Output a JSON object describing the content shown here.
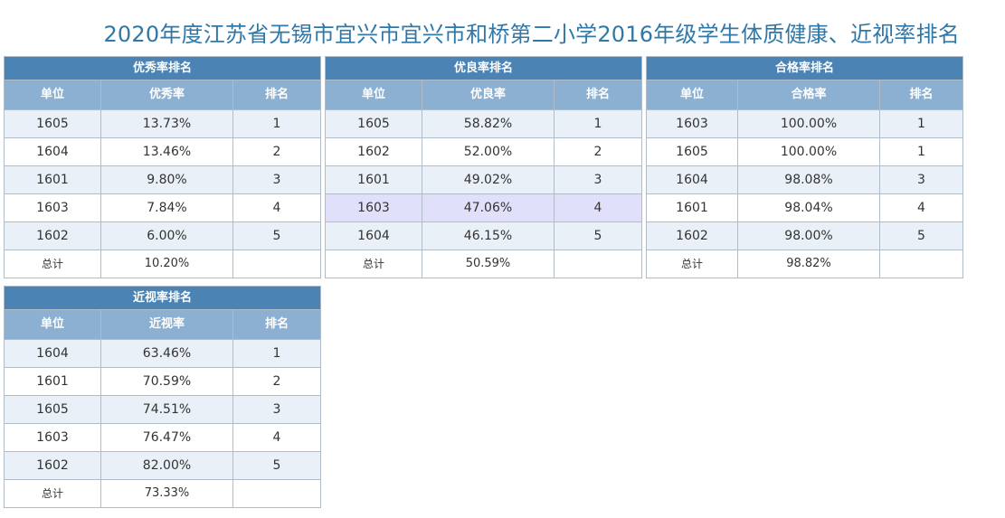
{
  "page": {
    "title": "2020年度江苏省无锡市宜兴市宜兴市和桥第二小学2016年级学生体质健康、近视率排名"
  },
  "tables": {
    "excellent": {
      "caption": "优秀率排名",
      "headers": [
        "单位",
        "优秀率",
        "排名"
      ],
      "rows": [
        [
          "1605",
          "13.73%",
          "1"
        ],
        [
          "1604",
          "13.46%",
          "2"
        ],
        [
          "1601",
          "9.80%",
          "3"
        ],
        [
          "1603",
          "7.84%",
          "4"
        ],
        [
          "1602",
          "6.00%",
          "5"
        ]
      ],
      "total": [
        "总计",
        "10.20%",
        ""
      ]
    },
    "good": {
      "caption": "优良率排名",
      "headers": [
        "单位",
        "优良率",
        "排名"
      ],
      "rows": [
        [
          "1605",
          "58.82%",
          "1"
        ],
        [
          "1602",
          "52.00%",
          "2"
        ],
        [
          "1601",
          "49.02%",
          "3"
        ],
        [
          "1603",
          "47.06%",
          "4"
        ],
        [
          "1604",
          "46.15%",
          "5"
        ]
      ],
      "total": [
        "总计",
        "50.59%",
        ""
      ]
    },
    "pass": {
      "caption": "合格率排名",
      "headers": [
        "单位",
        "合格率",
        "排名"
      ],
      "rows": [
        [
          "1603",
          "100.00%",
          "1"
        ],
        [
          "1605",
          "100.00%",
          "1"
        ],
        [
          "1604",
          "98.08%",
          "3"
        ],
        [
          "1601",
          "98.04%",
          "4"
        ],
        [
          "1602",
          "98.00%",
          "5"
        ]
      ],
      "total": [
        "总计",
        "98.82%",
        ""
      ]
    },
    "myopia": {
      "caption": "近视率排名",
      "headers": [
        "单位",
        "近视率",
        "排名"
      ],
      "rows": [
        [
          "1604",
          "63.46%",
          "1"
        ],
        [
          "1601",
          "70.59%",
          "2"
        ],
        [
          "1605",
          "74.51%",
          "3"
        ],
        [
          "1603",
          "76.47%",
          "4"
        ],
        [
          "1602",
          "82.00%",
          "5"
        ]
      ],
      "total": [
        "总计",
        "73.33%",
        ""
      ]
    }
  },
  "colors": {
    "title": "#2f78a8",
    "caption_bg": "#4b84b4",
    "header_bg": "#8cb0d1",
    "row_alt_bg": "#eaf0f7",
    "highlight_bg": "#e0e0fb"
  }
}
